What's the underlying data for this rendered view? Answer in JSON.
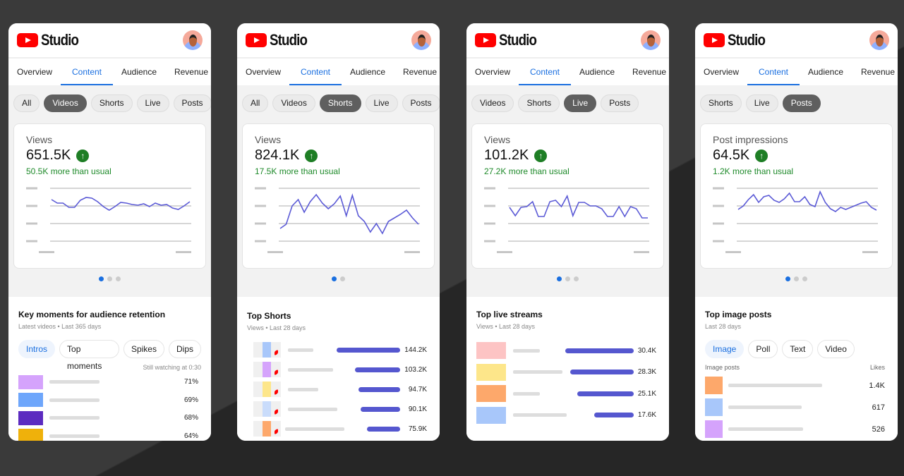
{
  "app": {
    "logo_text": "Studio",
    "tabs": [
      "Overview",
      "Content",
      "Audience",
      "Revenue"
    ],
    "active_tab": "Content"
  },
  "colors": {
    "accent": "#1a6fe0",
    "bar": "#5557cf",
    "positive": "#1e8a2a",
    "youtube_red": "#ff0000"
  },
  "screens": [
    {
      "chips": [
        "All",
        "Videos",
        "Shorts",
        "Live",
        "Posts"
      ],
      "active_chip": "Videos",
      "metric": {
        "title": "Views",
        "value": "651.5K",
        "delta": "50.5K more than usual",
        "trend_icon": "arrow-up-icon"
      },
      "sparkline": [
        59,
        54,
        54,
        48,
        48,
        58,
        62,
        61,
        56,
        49,
        44,
        49,
        55,
        54,
        52,
        51,
        53,
        49,
        54,
        51,
        52,
        47,
        45,
        50,
        56
      ],
      "pages": 3,
      "active_page": 0,
      "section": {
        "type": "retention",
        "title": "Key moments for audience retention",
        "subtitle": "Latest videos • Last 365 days",
        "chips": [
          "Intros",
          "Top moments",
          "Spikes",
          "Dips"
        ],
        "active_chip": "Intros",
        "caption": "Still watching at 0:30",
        "rows": [
          {
            "color": "#d5a3fc",
            "value": "71%"
          },
          {
            "color": "#6ea6fb",
            "value": "69%"
          },
          {
            "color": "#5c2bc0",
            "value": "68%"
          },
          {
            "color": "#efb10b",
            "value": "64%"
          }
        ]
      }
    },
    {
      "chips": [
        "All",
        "Videos",
        "Shorts",
        "Live",
        "Posts"
      ],
      "active_chip": "Shorts",
      "metric": {
        "title": "Views",
        "value": "824.1K",
        "delta": "17.5K more than usual",
        "trend_icon": "arrow-up-icon"
      },
      "sparkline": [
        18,
        24,
        50,
        59,
        41,
        56,
        66,
        54,
        46,
        53,
        64,
        36,
        65,
        36,
        28,
        13,
        25,
        11,
        28,
        33,
        38,
        44,
        33,
        24
      ],
      "pages": 2,
      "active_page": 0,
      "section": {
        "type": "shorts",
        "title": "Top Shorts",
        "subtitle": "Views • Last 28 days",
        "rows": [
          {
            "color": "#a8c7fa",
            "value": "144.2K",
            "num": 144.2
          },
          {
            "color": "#d5a3fc",
            "value": "103.2K",
            "num": 103.2
          },
          {
            "color": "#fde68a",
            "value": "94.7K",
            "num": 94.7
          },
          {
            "color": "#c9dcfb",
            "value": "90.1K",
            "num": 90.1
          },
          {
            "color": "#fda86b",
            "value": "75.9K",
            "num": 75.9
          }
        ]
      }
    },
    {
      "chips": [
        "Videos",
        "Shorts",
        "Live",
        "Posts"
      ],
      "active_chip": "Live",
      "metric": {
        "title": "Views",
        "value": "101.2K",
        "delta": "27.2K more than usual",
        "trend_icon": "arrow-up-icon"
      },
      "sparkline": [
        48,
        36,
        48,
        49,
        56,
        35,
        35,
        56,
        58,
        49,
        64,
        36,
        55,
        55,
        50,
        50,
        46,
        35,
        35,
        49,
        35,
        49,
        46,
        33,
        33
      ],
      "pages": 3,
      "active_page": 0,
      "section": {
        "type": "live",
        "title": "Top live streams",
        "subtitle": "Views • Last 28 days",
        "rows": [
          {
            "color": "#fdc4c4",
            "value": "30.4K",
            "num": 30.4
          },
          {
            "color": "#fde68a",
            "value": "28.3K",
            "num": 28.3
          },
          {
            "color": "#fda86b",
            "value": "25.1K",
            "num": 25.1
          },
          {
            "color": "#a8c7fa",
            "value": "17.6K",
            "num": 17.6
          }
        ]
      }
    },
    {
      "chips": [
        "Shorts",
        "Live",
        "Posts"
      ],
      "active_chip": "Posts",
      "metric": {
        "title": "Post impressions",
        "value": "64.5K",
        "delta": "1.2K more than usual",
        "trend_icon": "arrow-up-icon"
      },
      "sparkline": [
        45,
        50,
        59,
        66,
        55,
        63,
        65,
        58,
        55,
        60,
        68,
        56,
        56,
        63,
        52,
        49,
        70,
        55,
        46,
        42,
        48,
        45,
        48,
        51,
        54,
        56,
        48,
        44
      ],
      "pages": 3,
      "active_page": 0,
      "section": {
        "type": "posts",
        "title": "Top image posts",
        "subtitle": "Last 28 days",
        "chips": [
          "Image",
          "Poll",
          "Text",
          "Video"
        ],
        "active_chip": "Image",
        "col_left": "Image posts",
        "col_right": "Likes",
        "rows": [
          {
            "color": "#fda86b",
            "value": "1.4K"
          },
          {
            "color": "#a8c7fa",
            "value": "617"
          },
          {
            "color": "#d5a3fc",
            "value": "526"
          }
        ]
      }
    }
  ]
}
